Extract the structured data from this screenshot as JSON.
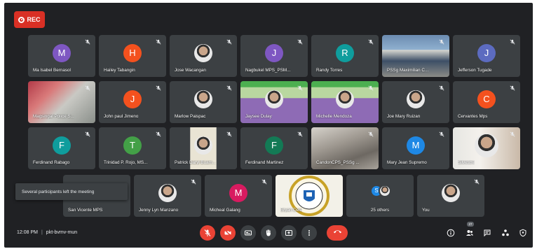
{
  "recording": {
    "label": "REC"
  },
  "participants": [
    {
      "name": "Ma Isabel Bernasol",
      "initial": "M",
      "color": "#7e57c2"
    },
    {
      "name": "Hailey Tabangin",
      "initial": "H",
      "color": "#f4511e"
    },
    {
      "name": "Jose Wacangan"
    },
    {
      "name": "Nagbukel MPS_PSM...",
      "initial": "J",
      "color": "#7e57c2"
    },
    {
      "name": "Randy Torres",
      "initial": "R",
      "color": "#0f9d9d"
    },
    {
      "name": "PSSg Maximilian C..."
    },
    {
      "name": "Jefferson Tugade",
      "initial": "J",
      "color": "#5c6bc0"
    },
    {
      "name": "Magsingal Police S..."
    },
    {
      "name": "John paul Jimeno",
      "initial": "J",
      "color": "#f4511e"
    },
    {
      "name": "Marlow Paispac"
    },
    {
      "name": "Jaysee Dulay"
    },
    {
      "name": "Michelle Mendoza"
    },
    {
      "name": "Joe Mary Ruizan"
    },
    {
      "name": "Cervantes Mps",
      "initial": "C",
      "color": "#f4511e"
    },
    {
      "name": "Ferdinand Rabago",
      "initial": "F",
      "color": "#0f9d9d"
    },
    {
      "name": "Trinidad P. Rojo, MS...",
      "initial": "T",
      "color": "#43a047"
    },
    {
      "name": "Patrick Daryl Buam..."
    },
    {
      "name": "Ferdinand Martinez",
      "initial": "F",
      "color": "#137a55"
    },
    {
      "name": "CandonCPS_PSSg ..."
    },
    {
      "name": "Mary Jean Supremo",
      "initial": "M",
      "color": "#1e88e5"
    },
    {
      "name": "Silvestre"
    },
    {
      "name": "San Vicente MPS"
    },
    {
      "name": "Jenny Lyn Manzano"
    },
    {
      "name": "Micheal Galang",
      "initial": "M",
      "color": "#d81b60"
    },
    {
      "name": "Bryan Dela"
    },
    {
      "name": "25 others",
      "initial": "S",
      "color": "#1e88e5"
    },
    {
      "name": "You"
    }
  ],
  "toast": {
    "message": "Several participants left the meeting"
  },
  "meeting": {
    "time": "12:08 PM",
    "separator": "|",
    "code": "pkt-bvmv-mun"
  },
  "people_count": "27",
  "colors": {
    "background": "#202124",
    "tile": "#3c4043",
    "danger": "#ea4335"
  }
}
